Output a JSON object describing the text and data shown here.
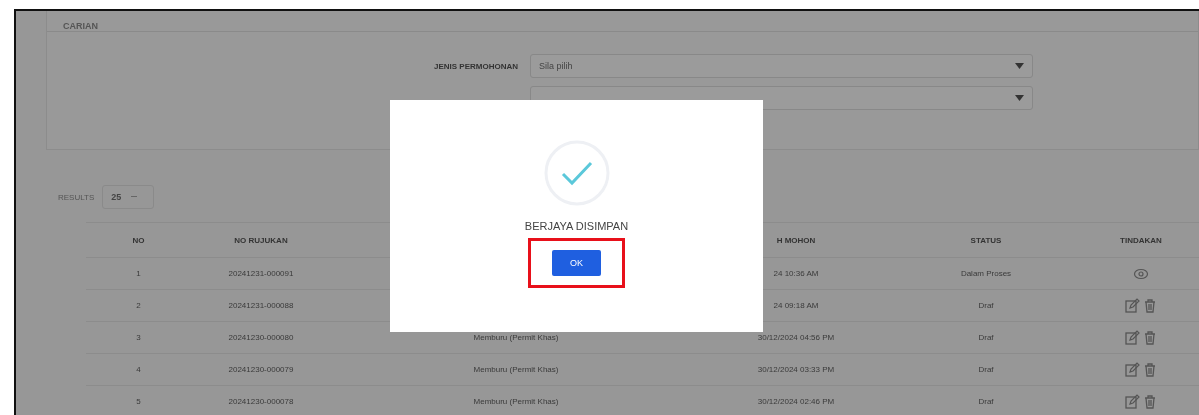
{
  "search_panel": {
    "title": "CARIAN",
    "filters": [
      {
        "label": "JENIS PERMOHONAN",
        "value": "Sila pilih"
      }
    ]
  },
  "results": {
    "label": "RESULTS",
    "page_size": "25"
  },
  "table": {
    "columns": [
      "NO",
      "NO RUJUKAN",
      "",
      "H MOHON",
      "STATUS",
      "TINDAKAN"
    ],
    "rows": [
      {
        "no": "1",
        "ref": "20241231-000091",
        "date": "24 10:36 AM",
        "status": "Dalam Proses",
        "kind": "view"
      },
      {
        "no": "2",
        "ref": "20241231-000088",
        "date": "24 09:18 AM",
        "status": "Draf",
        "kind": "edit"
      },
      {
        "no": "3",
        "ref": "20241230-000080",
        "type": "Memburu (Permit Khas)",
        "date": "30/12/2024 04:56 PM",
        "status": "Draf",
        "kind": "edit"
      },
      {
        "no": "4",
        "ref": "20241230-000079",
        "type": "Memburu (Permit Khas)",
        "date": "30/12/2024 03:33 PM",
        "status": "Draf",
        "kind": "edit"
      },
      {
        "no": "5",
        "ref": "20241230-000078",
        "type": "Memburu (Permit Khas)",
        "date": "30/12/2024 02:46 PM",
        "status": "Draf",
        "kind": "edit"
      }
    ]
  },
  "dialog": {
    "message": "BERJAYA DISIMPAN",
    "button": "OK",
    "button_highlighted": true
  }
}
